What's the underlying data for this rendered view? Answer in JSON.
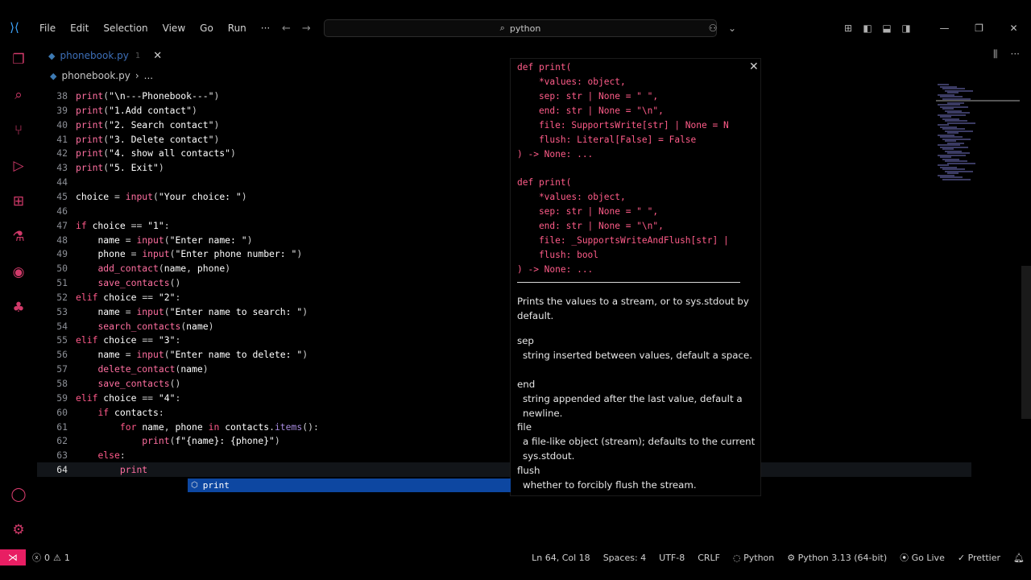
{
  "app": {
    "logo_icon": "vscode-logo-icon"
  },
  "menu": [
    "File",
    "Edit",
    "Selection",
    "View",
    "Go",
    "Run",
    "···"
  ],
  "command_center": {
    "text": "python"
  },
  "tab": {
    "label": "phonebook.py",
    "suffix": "1"
  },
  "breadcrumb": {
    "file": "phonebook.py",
    "more": "..."
  },
  "code": [
    {
      "n": "38",
      "t": [
        [
          "call",
          "print"
        ],
        [
          "pn",
          "("
        ],
        [
          "str",
          "\"\\n---Phonebook---\""
        ],
        [
          "pn",
          ")"
        ]
      ]
    },
    {
      "n": "39",
      "t": [
        [
          "call",
          "print"
        ],
        [
          "pn",
          "("
        ],
        [
          "str",
          "\"1.Add contact\""
        ],
        [
          "pn",
          ")"
        ]
      ]
    },
    {
      "n": "40",
      "t": [
        [
          "call",
          "print"
        ],
        [
          "pn",
          "("
        ],
        [
          "str",
          "\"2. Search contact\""
        ],
        [
          "pn",
          ")"
        ]
      ]
    },
    {
      "n": "41",
      "t": [
        [
          "call",
          "print"
        ],
        [
          "pn",
          "("
        ],
        [
          "str",
          "\"3. Delete contact\""
        ],
        [
          "pn",
          ")"
        ]
      ]
    },
    {
      "n": "42",
      "t": [
        [
          "call",
          "print"
        ],
        [
          "pn",
          "("
        ],
        [
          "str",
          "\"4. show all contacts\""
        ],
        [
          "pn",
          ")"
        ]
      ]
    },
    {
      "n": "43",
      "t": [
        [
          "call",
          "print"
        ],
        [
          "pn",
          "("
        ],
        [
          "str",
          "\"5. Exit\""
        ],
        [
          "pn",
          ")"
        ]
      ]
    },
    {
      "n": "44",
      "t": []
    },
    {
      "n": "45",
      "t": [
        [
          "var",
          "choice "
        ],
        [
          "pn",
          "= "
        ],
        [
          "call",
          "input"
        ],
        [
          "pn",
          "("
        ],
        [
          "str",
          "\"Your choice: \""
        ],
        [
          "pn",
          ")"
        ]
      ]
    },
    {
      "n": "46",
      "t": []
    },
    {
      "n": "47",
      "t": [
        [
          "kw",
          "if "
        ],
        [
          "var",
          "choice "
        ],
        [
          "pn",
          "== "
        ],
        [
          "str",
          "\"1\""
        ],
        [
          "pn",
          ":"
        ]
      ]
    },
    {
      "n": "48",
      "t": [
        [
          "pn",
          "    "
        ],
        [
          "var",
          "name "
        ],
        [
          "pn",
          "= "
        ],
        [
          "call",
          "input"
        ],
        [
          "pn",
          "("
        ],
        [
          "str",
          "\"Enter name: \""
        ],
        [
          "pn",
          ")"
        ]
      ]
    },
    {
      "n": "49",
      "t": [
        [
          "pn",
          "    "
        ],
        [
          "var",
          "phone "
        ],
        [
          "pn",
          "= "
        ],
        [
          "call",
          "input"
        ],
        [
          "pn",
          "("
        ],
        [
          "str",
          "\"Enter phone number: \""
        ],
        [
          "pn",
          ")"
        ]
      ]
    },
    {
      "n": "50",
      "t": [
        [
          "pn",
          "    "
        ],
        [
          "call",
          "add_contact"
        ],
        [
          "pn",
          "("
        ],
        [
          "var",
          "name"
        ],
        [
          "pn",
          ", "
        ],
        [
          "var",
          "phone"
        ],
        [
          "pn",
          ")"
        ]
      ]
    },
    {
      "n": "51",
      "t": [
        [
          "pn",
          "    "
        ],
        [
          "call",
          "save_contacts"
        ],
        [
          "pn",
          "()"
        ]
      ]
    },
    {
      "n": "52",
      "t": [
        [
          "kw",
          "elif "
        ],
        [
          "var",
          "choice "
        ],
        [
          "pn",
          "== "
        ],
        [
          "str",
          "\"2\""
        ],
        [
          "pn",
          ":"
        ]
      ]
    },
    {
      "n": "53",
      "t": [
        [
          "pn",
          "    "
        ],
        [
          "var",
          "name "
        ],
        [
          "pn",
          "= "
        ],
        [
          "call",
          "input"
        ],
        [
          "pn",
          "("
        ],
        [
          "str",
          "\"Enter name to search: \""
        ],
        [
          "pn",
          ")"
        ]
      ]
    },
    {
      "n": "54",
      "t": [
        [
          "pn",
          "    "
        ],
        [
          "call",
          "search_contacts"
        ],
        [
          "pn",
          "("
        ],
        [
          "var",
          "name"
        ],
        [
          "pn",
          ")"
        ]
      ]
    },
    {
      "n": "55",
      "t": [
        [
          "kw",
          "elif "
        ],
        [
          "var",
          "choice "
        ],
        [
          "pn",
          "== "
        ],
        [
          "str",
          "\"3\""
        ],
        [
          "pn",
          ":"
        ]
      ]
    },
    {
      "n": "56",
      "t": [
        [
          "pn",
          "    "
        ],
        [
          "var",
          "name "
        ],
        [
          "pn",
          "= "
        ],
        [
          "call",
          "input"
        ],
        [
          "pn",
          "("
        ],
        [
          "str",
          "\"Enter name to delete: \""
        ],
        [
          "pn",
          ")"
        ]
      ]
    },
    {
      "n": "57",
      "t": [
        [
          "pn",
          "    "
        ],
        [
          "call",
          "delete_contact"
        ],
        [
          "pn",
          "("
        ],
        [
          "var",
          "name"
        ],
        [
          "pn",
          ")"
        ]
      ]
    },
    {
      "n": "58",
      "t": [
        [
          "pn",
          "    "
        ],
        [
          "call",
          "save_contacts"
        ],
        [
          "pn",
          "()"
        ]
      ]
    },
    {
      "n": "59",
      "t": [
        [
          "kw",
          "elif "
        ],
        [
          "var",
          "choice "
        ],
        [
          "pn",
          "== "
        ],
        [
          "str",
          "\"4\""
        ],
        [
          "pn",
          ":"
        ]
      ]
    },
    {
      "n": "60",
      "t": [
        [
          "pn",
          "    "
        ],
        [
          "kw",
          "if "
        ],
        [
          "var",
          "contacts"
        ],
        [
          "pn",
          ":"
        ]
      ]
    },
    {
      "n": "61",
      "t": [
        [
          "pn",
          "        "
        ],
        [
          "kw",
          "for "
        ],
        [
          "var",
          "name"
        ],
        [
          "pn",
          ", "
        ],
        [
          "var",
          "phone "
        ],
        [
          "kw",
          "in "
        ],
        [
          "var",
          "contacts"
        ],
        [
          "pn",
          "."
        ],
        [
          "mth",
          "items"
        ],
        [
          "pn",
          "():"
        ]
      ]
    },
    {
      "n": "62",
      "t": [
        [
          "pn",
          "            "
        ],
        [
          "call",
          "print"
        ],
        [
          "pn",
          "("
        ],
        [
          "str",
          "f\"{name}: {phone}\""
        ],
        [
          "pn",
          ")"
        ]
      ]
    },
    {
      "n": "63",
      "t": [
        [
          "pn",
          "    "
        ],
        [
          "kw",
          "else"
        ],
        [
          "pn",
          ":"
        ]
      ]
    },
    {
      "n": "64",
      "t": [
        [
          "pn",
          "        "
        ],
        [
          "call",
          "print"
        ]
      ]
    }
  ],
  "hover": {
    "signature_1": [
      "def print(",
      "    *values: object,",
      "    sep: str | None = \" \",",
      "    end: str | None = \"\\n\",",
      "    file: SupportsWrite[str] | None = N",
      "    flush: Literal[False] = False",
      ") -> None: ..."
    ],
    "signature_2": [
      "def print(",
      "    *values: object,",
      "    sep: str | None = \" \",",
      "    end: str | None = \"\\n\",",
      "    file: _SupportsWriteAndFlush[str] |",
      "    flush: bool",
      ") -> None: ..."
    ],
    "description": "Prints the values to a stream, or to sys.stdout by default.",
    "params": [
      {
        "name": "sep",
        "desc": "string inserted between values, default a space."
      },
      {
        "name": "end",
        "desc": "string appended after the last value, default a newline."
      },
      {
        "name": "file",
        "desc": "a file-like object (stream); defaults to the current sys.stdout."
      },
      {
        "name": "flush",
        "desc": "whether to forcibly flush the stream."
      }
    ]
  },
  "suggestion": {
    "label": "print",
    "icon": "method-cube-icon"
  },
  "status": {
    "errors": "0",
    "warnings": "1",
    "position": "Ln 64, Col 18",
    "spaces": "Spaces: 4",
    "encoding": "UTF-8",
    "eol": "CRLF",
    "language": "Python",
    "interpreter": "Python 3.13 (64-bit)",
    "go_live": "Go Live",
    "prettier": "Prettier"
  }
}
